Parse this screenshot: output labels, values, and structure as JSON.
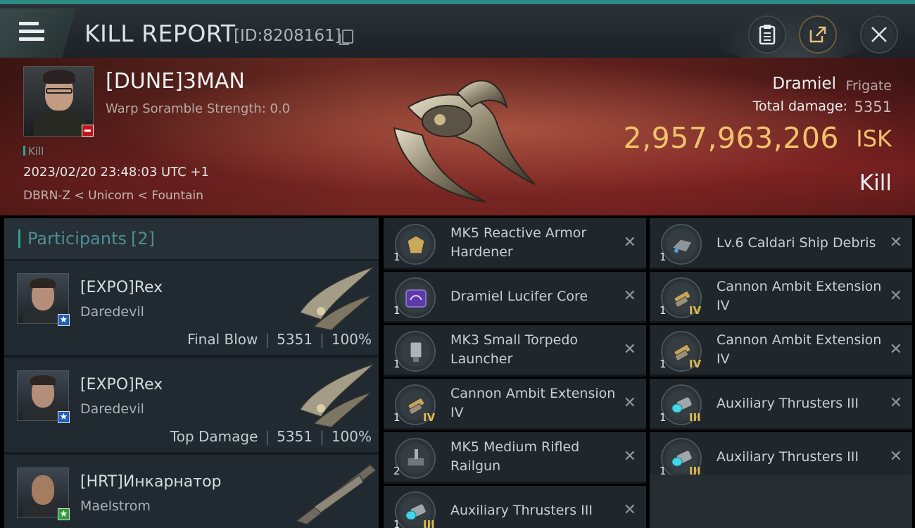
{
  "header": {
    "menu_icon": "hamburger-icon",
    "title": "KILL REPORT",
    "report_id": "[ID:8208161]",
    "copy_icon": "copy-icon",
    "buttons": [
      {
        "icon": "clipboard-icon"
      },
      {
        "icon": "share-icon"
      },
      {
        "icon": "close-icon"
      }
    ]
  },
  "victim": {
    "name": "[DUNE]3MAN",
    "warp_scramble": "Warp Soramble Strength: 0.0",
    "tag": "Kill",
    "datetime": "2023/02/20 23:48:03 UTC +1",
    "location": "DBRN-Z < Unicorn < Fountain",
    "ship_name": "Dramiel",
    "ship_class": "Frigate",
    "total_damage_label": "Total damage:",
    "total_damage_value": "5351",
    "isk_value": "2,957,963,206",
    "isk_label": "ISK",
    "outcome": "Kill"
  },
  "participants": {
    "title": "Participants",
    "count": "[2]",
    "list": [
      {
        "name": "[EXPO]Rex",
        "ship": "Daredevil",
        "role": "Final Blow",
        "damage": "5351",
        "percent": "100%",
        "badge": "blue-star"
      },
      {
        "name": "[EXPO]Rex",
        "ship": "Daredevil",
        "role": "Top Damage",
        "damage": "5351",
        "percent": "100%",
        "badge": "blue-star"
      },
      {
        "name": "[HRT]Инкарнатор",
        "ship": "Maelstrom",
        "role": "",
        "damage": "",
        "percent": "",
        "badge": "green-star"
      }
    ]
  },
  "items": {
    "col1": [
      {
        "name": "MK5 Reactive Armor Hardener",
        "qty": "1",
        "tier": "",
        "icon": "armor-hardener-icon"
      },
      {
        "name": "Dramiel Lucifer Core",
        "qty": "1",
        "tier": "",
        "icon": "core-icon"
      },
      {
        "name": "MK3 Small Torpedo Launcher",
        "qty": "1",
        "tier": "",
        "icon": "torpedo-launcher-icon"
      },
      {
        "name": "Cannon Ambit Extension IV",
        "qty": "1",
        "tier": "IV",
        "icon": "cannon-ambit-icon"
      },
      {
        "name": "MK5 Medium Rifled Railgun",
        "qty": "2",
        "tier": "",
        "icon": "railgun-icon"
      },
      {
        "name": "Auxiliary Thrusters III",
        "qty": "1",
        "tier": "III",
        "icon": "thruster-icon"
      }
    ],
    "col2": [
      {
        "name": "Lv.6 Caldari Ship Debris",
        "qty": "1",
        "tier": "",
        "icon": "debris-icon"
      },
      {
        "name": "Cannon Ambit Extension IV",
        "qty": "1",
        "tier": "IV",
        "icon": "cannon-ambit-icon"
      },
      {
        "name": "Cannon Ambit Extension IV",
        "qty": "1",
        "tier": "IV",
        "icon": "cannon-ambit-icon"
      },
      {
        "name": "Auxiliary Thrusters III",
        "qty": "1",
        "tier": "III",
        "icon": "thruster-icon"
      },
      {
        "name": "Auxiliary Thrusters III",
        "qty": "1",
        "tier": "III",
        "icon": "thruster-icon"
      }
    ],
    "remove_glyph": "✕"
  },
  "colors": {
    "accent": "#2fa592",
    "isk": "#f0c36b",
    "tier": "#e1b94e"
  }
}
